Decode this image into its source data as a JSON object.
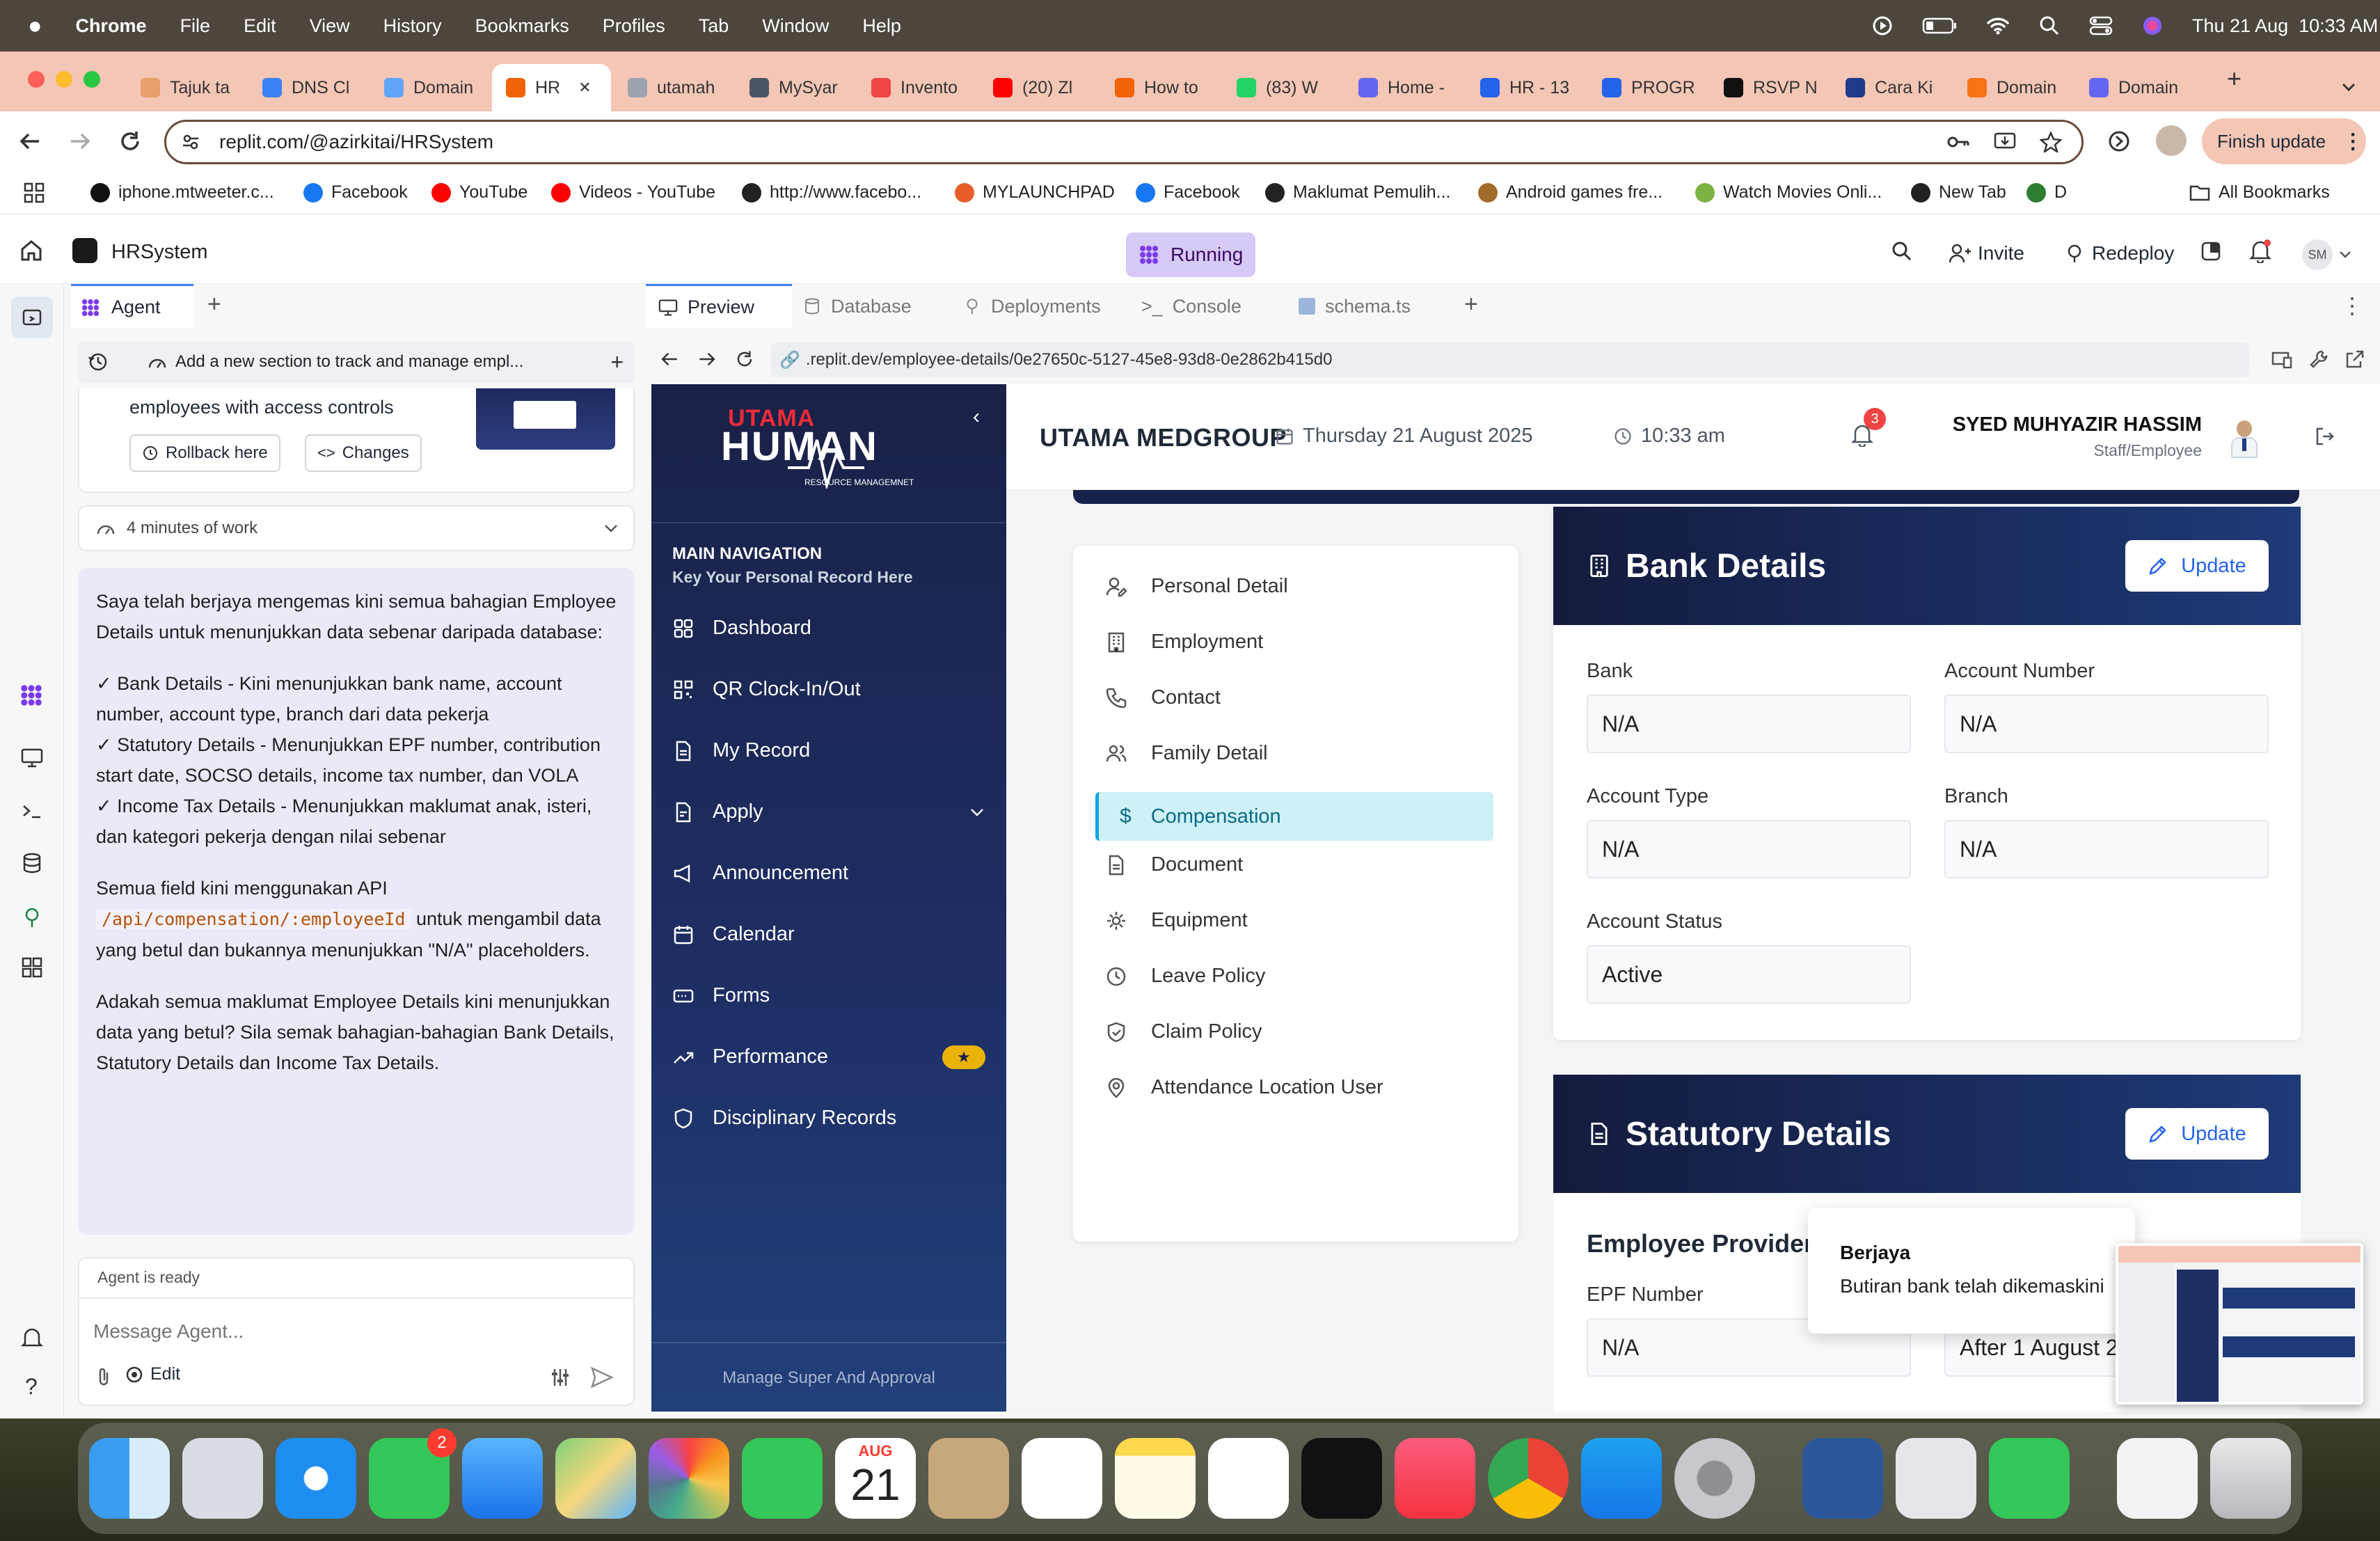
{
  "menubar": {
    "app": "Chrome",
    "items": [
      "File",
      "Edit",
      "View",
      "History",
      "Bookmarks",
      "Profiles",
      "Tab",
      "Window",
      "Help"
    ],
    "clock": "Thu 21 Aug  10:33 AM"
  },
  "tabs": [
    {
      "label": "Tajuk ta",
      "color": "#e8a06a"
    },
    {
      "label": "DNS Cl",
      "color": "#3b82f6"
    },
    {
      "label": "Domain",
      "color": "#60a5fa"
    },
    {
      "label": "HR",
      "color": "#f26207"
    },
    {
      "label": "utamah",
      "color": "#9ca3af"
    },
    {
      "label": "MySyar",
      "color": "#4b5563"
    },
    {
      "label": "Invento",
      "color": "#ef4444"
    },
    {
      "label": "(20) Zl",
      "color": "#ff0000"
    },
    {
      "label": "How to",
      "color": "#f26207"
    },
    {
      "label": "(83) W",
      "color": "#25d366"
    },
    {
      "label": "Home -",
      "color": "#6366f1"
    },
    {
      "label": "HR - 13",
      "color": "#2563eb"
    },
    {
      "label": "PROGR",
      "color": "#2563eb"
    },
    {
      "label": "RSVP N",
      "color": "#111111"
    },
    {
      "label": "Cara Ki",
      "color": "#1e3a8a"
    },
    {
      "label": "Domain",
      "color": "#f97316"
    },
    {
      "label": "Domain",
      "color": "#6366f1"
    }
  ],
  "browser": {
    "url": "replit.com/@azirkitai/HRSystem",
    "finish_update": "Finish update"
  },
  "bookmarks": [
    {
      "label": "iphone.mtweeter.c...",
      "color": "#111"
    },
    {
      "label": "Facebook",
      "color": "#1877f2"
    },
    {
      "label": "YouTube",
      "color": "#ff0000"
    },
    {
      "label": "Videos - YouTube",
      "color": "#ff0000"
    },
    {
      "label": "http://www.facebo...",
      "color": "#222"
    },
    {
      "label": "MYLAUNCHPAD",
      "color": "#e85d2a"
    },
    {
      "label": "Facebook",
      "color": "#1877f2"
    },
    {
      "label": "Maklumat Pemulih...",
      "color": "#222"
    },
    {
      "label": "Android games fre...",
      "color": "#a36b2a"
    },
    {
      "label": "Watch Movies Onli...",
      "color": "#7cb342"
    },
    {
      "label": "New Tab",
      "color": "#222"
    },
    {
      "label": "D",
      "color": "#2e7d32"
    }
  ],
  "all_bookmarks": "All Bookmarks",
  "replit": {
    "project": "HRSystem",
    "status": "Running",
    "invite": "Invite",
    "redeploy": "Redeploy",
    "avatar": "SM",
    "agent_tab": "Agent",
    "task_title": "Add a new section to track and manage empl...",
    "prev_message_tail": "employees with access controls",
    "rollback": "Rollback here",
    "changes": "Changes",
    "work_time": "4 minutes of work",
    "msg_p1": "Saya telah berjaya mengemas kini semua bahagian Employee Details untuk menunjukkan data sebenar daripada database:",
    "msg_check1": "✓ Bank Details - Kini menunjukkan bank name, account number, account type, branch dari data pekerja",
    "msg_check2": "✓ Statutory Details - Menunjukkan EPF number, contribution start date, SOCSO details, income tax number, dan VOLA",
    "msg_check3": "✓ Income Tax Details - Menunjukkan maklumat anak, isteri, dan kategori pekerja dengan nilai sebenar",
    "msg_p2a": "Semua field kini menggunakan API",
    "msg_code": "/api/compensation/:employeeId",
    "msg_p2b": "untuk mengambil data yang betul dan bukannya menunjukkan \"N/A\" placeholders.",
    "msg_p3": "Adakah semua maklumat Employee Details kini menunjukkan data yang betul? Sila semak bahagian-bahagian Bank Details, Statutory Details dan Income Tax Details.",
    "agent_ready": "Agent is ready",
    "input_placeholder": "Message Agent...",
    "edit": "Edit",
    "pane_tabs": [
      "Preview",
      "Database",
      "Deployments",
      "Console",
      "schema.ts"
    ],
    "preview_url": ".replit.dev/employee-details/0e27650c-5127-45e8-93d8-0e2862b415d0"
  },
  "hr": {
    "logo_top": "UTAMA",
    "logo_main": "HUMAN",
    "logo_sub": "RESOURCE MANAGEMNET",
    "nav_title": "MAIN NAVIGATION",
    "nav_subtitle": "Key Your Personal Record Here",
    "nav": [
      "Dashboard",
      "QR Clock-In/Out",
      "My Record",
      "Apply",
      "Announcement",
      "Calendar",
      "Forms",
      "Performance",
      "Disciplinary Records"
    ],
    "sidebar_footer": "Manage Super And Approval",
    "company": "UTAMA MEDGROUP",
    "date": "Thursday 21 August 2025",
    "time": "10:33 am",
    "notif_count": "3",
    "user_name": "SYED MUHYAZIR HASSIM",
    "user_role": "Staff/Employee",
    "menu": [
      "Personal Detail",
      "Employment",
      "Contact",
      "Family Detail",
      "Compensation",
      "Document",
      "Equipment",
      "Leave Policy",
      "Claim Policy",
      "Attendance Location User"
    ],
    "bank_title": "Bank Details",
    "update": "Update",
    "bank_label": "Bank",
    "bank_value": "N/A",
    "acct_no_label": "Account Number",
    "acct_no_value": "N/A",
    "acct_type_label": "Account Type",
    "acct_type_value": "N/A",
    "branch_label": "Branch",
    "branch_value": "N/A",
    "acct_status_label": "Account Status",
    "acct_status_value": "Active",
    "statutory_title": "Statutory Details",
    "epf_section": "Employee Provider",
    "epf_label": "EPF Number",
    "epf_value": "N/A",
    "epf_right_value": "After 1 August 2"
  },
  "toast": {
    "title": "Berjaya",
    "body": "Butiran bank telah dikemaskini"
  },
  "dock": {
    "calendar_month": "AUG",
    "calendar_day": "21",
    "messages_badge": "2"
  }
}
